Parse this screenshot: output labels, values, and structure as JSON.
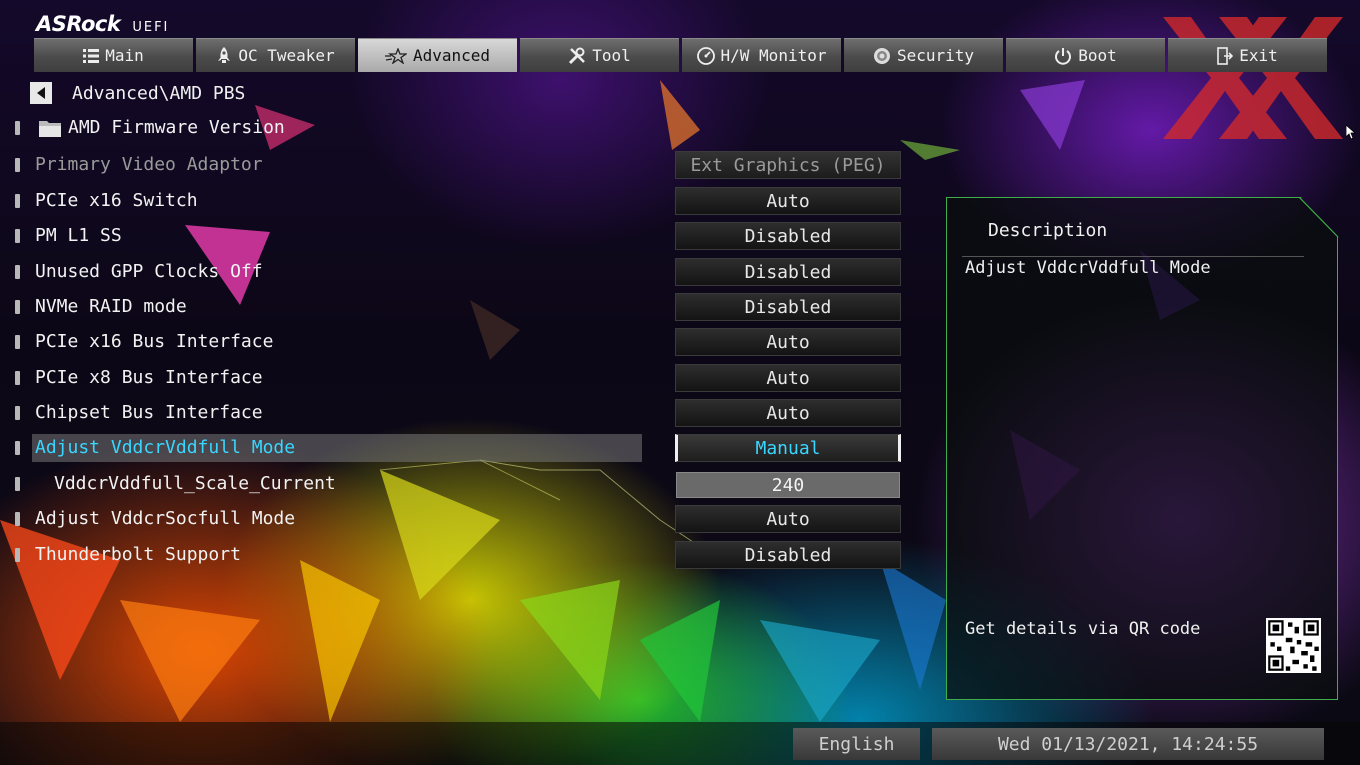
{
  "brand": {
    "name": "ASRock",
    "sub": "UEFI"
  },
  "tabs": [
    {
      "label": "Main",
      "icon": "list-icon",
      "active": false
    },
    {
      "label": "OC Tweaker",
      "icon": "rocket-icon",
      "active": false
    },
    {
      "label": "Advanced",
      "icon": "star-icon",
      "active": true
    },
    {
      "label": "Tool",
      "icon": "tools-icon",
      "active": false
    },
    {
      "label": "H/W Monitor",
      "icon": "monitor-icon",
      "active": false
    },
    {
      "label": "Security",
      "icon": "shield-icon",
      "active": false
    },
    {
      "label": "Boot",
      "icon": "power-icon",
      "active": false
    },
    {
      "label": "Exit",
      "icon": "exit-icon",
      "active": false
    }
  ],
  "breadcrumb": "Advanced\\AMD PBS",
  "settings": [
    {
      "label": "AMD Firmware Version",
      "value": ""
    },
    {
      "label": "Primary Video Adaptor",
      "value": "Ext Graphics (PEG)"
    },
    {
      "label": "PCIe x16 Switch",
      "value": "Auto"
    },
    {
      "label": "PM L1 SS",
      "value": "Disabled"
    },
    {
      "label": "Unused GPP Clocks Off",
      "value": "Disabled"
    },
    {
      "label": "NVMe RAID mode",
      "value": "Disabled"
    },
    {
      "label": "PCIe x16 Bus Interface",
      "value": "Auto"
    },
    {
      "label": "PCIe x8 Bus Interface",
      "value": "Auto"
    },
    {
      "label": "Chipset Bus Interface",
      "value": "Auto"
    },
    {
      "label": "Adjust VddcrVddfull Mode",
      "value": "Manual"
    },
    {
      "label": "VddcrVddfull_Scale_Current",
      "value": "240"
    },
    {
      "label": "Adjust VddcrSocfull Mode",
      "value": "Auto"
    },
    {
      "label": "Thunderbolt Support",
      "value": "Disabled"
    }
  ],
  "description": {
    "title": "Description",
    "text": "Adjust VddcrVddfull Mode",
    "qr_text": "Get details via QR code"
  },
  "footer": {
    "language": "English",
    "datetime": "Wed 01/13/2021, 14:24:55"
  },
  "colors": {
    "accent": "#39d6ff",
    "panel_border": "#3fae4a",
    "watermark": "#d42a2a"
  }
}
